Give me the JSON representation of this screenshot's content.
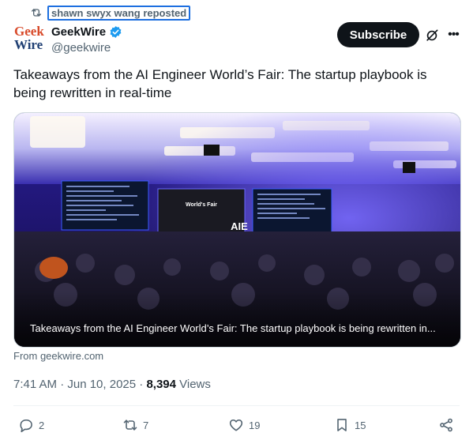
{
  "repost": {
    "label": "shawn swyx wang reposted",
    "icon": "repost-icon"
  },
  "author": {
    "logo_line1": "Geek",
    "logo_line2": "Wire",
    "name": "GeekWire",
    "handle": "@geekwire",
    "verified_icon": "verified-badge-icon"
  },
  "header": {
    "subscribe_label": "Subscribe",
    "grok_icon": "grok-icon",
    "more_icon": "more-icon"
  },
  "tweet": {
    "text": "Takeaways from the AI Engineer World’s Fair: The startup playbook is being rewritten in real-time"
  },
  "card": {
    "caption": "Takeaways from the AI Engineer World’s Fair: The startup playbook is being rewritten in...",
    "stage_text": "AIE",
    "screen_text": "World's Fair",
    "from": "From geekwire.com"
  },
  "meta": {
    "time": "7:41 AM · Jun 10, 2025 · ",
    "views_count": "8,394",
    "views_label": " Views"
  },
  "actions": {
    "replies": "2",
    "reposts": "7",
    "likes": "19",
    "bookmarks": "15"
  },
  "colors": {
    "accent": "#1d9bf0",
    "muted": "#536471",
    "text": "#0f1419"
  }
}
